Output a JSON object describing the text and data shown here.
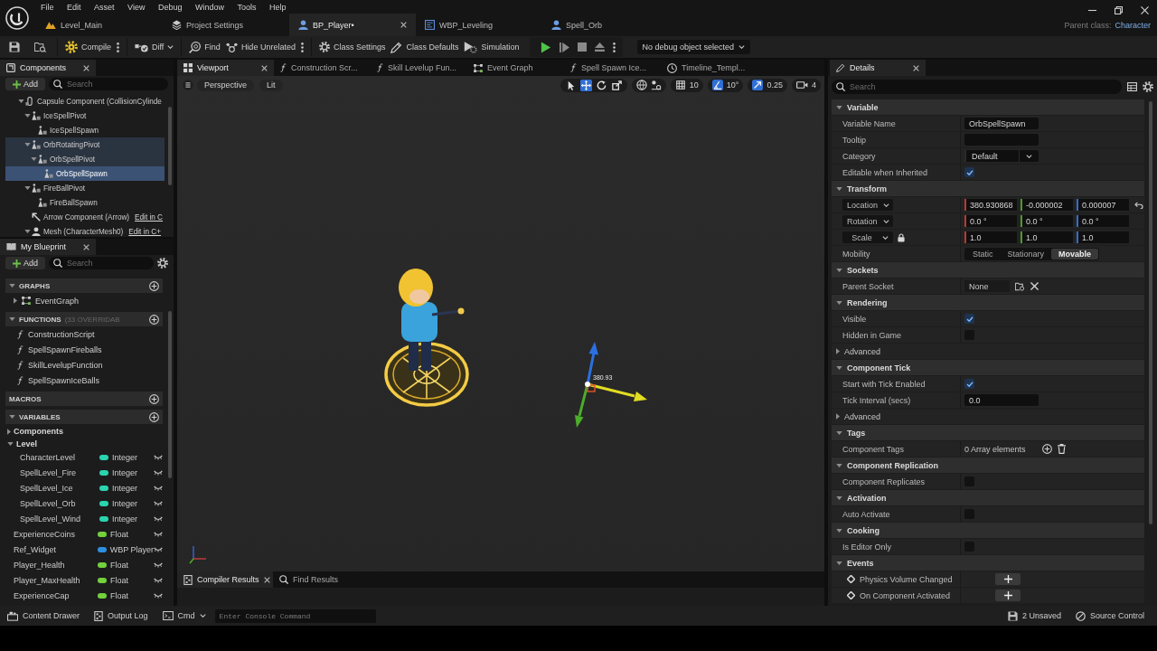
{
  "menu_bar": [
    "File",
    "Edit",
    "Asset",
    "View",
    "Debug",
    "Window",
    "Tools",
    "Help"
  ],
  "document_tabs": [
    {
      "label": "Level_Main",
      "kind": "level",
      "selected": false
    },
    {
      "label": "Project Settings",
      "kind": "settings",
      "selected": false
    },
    {
      "label": "BP_Player•",
      "kind": "blueprint",
      "selected": true
    },
    {
      "label": "WBP_Leveling",
      "kind": "widget",
      "selected": false
    },
    {
      "label": "Spell_Orb",
      "kind": "blueprint",
      "selected": false
    }
  ],
  "parent_class": {
    "label": "Parent class:",
    "value": "Character"
  },
  "toolbar": {
    "buttons": [
      {
        "label": "Compile",
        "kind": "compile"
      },
      {
        "label": "Diff",
        "kind": "diff"
      },
      {
        "label": "Find",
        "kind": "find"
      },
      {
        "label": "Hide Unrelated",
        "kind": "hide"
      },
      {
        "label": "Class Settings",
        "kind": "class_settings"
      },
      {
        "label": "Class Defaults",
        "kind": "class_defaults"
      },
      {
        "label": "Simulation",
        "kind": "simulation"
      }
    ],
    "debug_selector": "No debug object selected"
  },
  "components_panel": {
    "title": "Components",
    "add_label": "Add",
    "search_placeholder": "Search",
    "tree": [
      {
        "label": "Capsule Component (CollisionCylinde",
        "kind": "capsule",
        "expanded": true,
        "selected": false,
        "children": [
          {
            "label": "IceSpellPivot",
            "kind": "scene",
            "expanded": true,
            "selected": false,
            "children": [
              {
                "label": "IceSpellSpawn",
                "kind": "scene",
                "selected": false
              }
            ]
          },
          {
            "label": "OrbRotatingPivot",
            "kind": "scene",
            "expanded": true,
            "selected": false,
            "children": [
              {
                "label": "OrbSpellPivot",
                "kind": "scene",
                "expanded": true,
                "selected": false,
                "children": [
                  {
                    "label": "OrbSpellSpawn",
                    "kind": "scene",
                    "selected": true
                  }
                ]
              }
            ]
          },
          {
            "label": "FireBallPivot",
            "kind": "scene",
            "expanded": true,
            "selected": false,
            "children": [
              {
                "label": "FireBallSpawn",
                "kind": "scene",
                "selected": false
              }
            ]
          },
          {
            "label": "Arrow Component (Arrow)",
            "kind": "arrow",
            "selected": false,
            "link": "Edit in C"
          },
          {
            "label": "Mesh (CharacterMesh0)",
            "kind": "mesh",
            "expanded": true,
            "selected": false,
            "link": "Edit in C+"
          }
        ]
      }
    ]
  },
  "my_blueprint": {
    "title": "My Blueprint",
    "add_label": "Add",
    "search_placeholder": "Search",
    "sections": [
      {
        "title": "GRAPHS",
        "expanded": true,
        "items": [
          {
            "label": "EventGraph",
            "kind": "graph",
            "expanded": false
          }
        ]
      },
      {
        "title": "FUNCTIONS",
        "note": "(33 OVERRIDAB",
        "expanded": true,
        "items": [
          {
            "label": "ConstructionScript",
            "kind": "construction"
          },
          {
            "label": "SpellSpawnFireballs",
            "kind": "function"
          },
          {
            "label": "SkillLevelupFunction",
            "kind": "function"
          },
          {
            "label": "SpellSpawnIceBalls",
            "kind": "function"
          }
        ]
      },
      {
        "title": "MACROS"
      },
      {
        "title": "VARIABLES",
        "expanded": true,
        "groups": [
          {
            "label": "Components",
            "expanded": false
          },
          {
            "label": "Level",
            "expanded": true,
            "items": [
              {
                "name": "CharacterLevel",
                "type": "Integer",
                "color": "#2ad4b0"
              },
              {
                "name": "SpellLevel_Fire",
                "type": "Integer",
                "color": "#2ad4b0"
              },
              {
                "name": "SpellLevel_Ice",
                "type": "Integer",
                "color": "#2ad4b0"
              },
              {
                "name": "SpellLevel_Orb",
                "type": "Integer",
                "color": "#2ad4b0"
              },
              {
                "name": "SpellLevel_Wind",
                "type": "Integer",
                "color": "#2ad4b0"
              }
            ]
          }
        ],
        "items": [
          {
            "name": "ExperienceCoins",
            "type": "Float",
            "color": "#72d13c"
          },
          {
            "name": "Ref_Widget",
            "type": "WBP Player",
            "color": "#2d8fe0"
          },
          {
            "name": "Player_Health",
            "type": "Float",
            "color": "#72d13c"
          },
          {
            "name": "Player_MaxHealth",
            "type": "Float",
            "color": "#72d13c"
          },
          {
            "name": "ExperienceCap",
            "type": "Float",
            "color": "#72d13c"
          }
        ]
      }
    ]
  },
  "editor_tabs": [
    {
      "label": "Viewport",
      "kind": "viewport",
      "selected": true
    },
    {
      "label": "Construction Scr...",
      "kind": "function",
      "selected": false
    },
    {
      "label": "Skill Levelup Fun...",
      "kind": "function",
      "selected": false
    },
    {
      "label": "Event Graph",
      "kind": "graph",
      "selected": false
    },
    {
      "label": "Spell Spawn Ice...",
      "kind": "function",
      "selected": false
    },
    {
      "label": "Timeline_Templ...",
      "kind": "timeline",
      "selected": false
    }
  ],
  "viewport": {
    "view_mode": "Perspective",
    "lighting": "Lit",
    "transform_tools": [
      {
        "kind": "select",
        "selected": false
      },
      {
        "kind": "translate",
        "selected": true
      },
      {
        "kind": "rotate",
        "selected": false
      },
      {
        "kind": "scale",
        "selected": false
      }
    ],
    "snaps": [
      {
        "kind": "grid",
        "value": "10",
        "on": false
      },
      {
        "kind": "angle",
        "value": "10°",
        "on": true
      },
      {
        "kind": "scale",
        "value": "0.25",
        "on": true
      },
      {
        "kind": "camera",
        "value": "4",
        "on": false
      }
    ],
    "gizmo_reading": "380.93"
  },
  "bottom_tabs": [
    {
      "label": "Compiler Results",
      "kind": "compiler",
      "selected": true
    },
    {
      "label": "Find Results",
      "kind": "find",
      "selected": false
    }
  ],
  "details": {
    "title": "Details",
    "search_placeholder": "Search",
    "sections": [
      {
        "title": "Variable",
        "expanded": true,
        "rows": [
          {
            "kind": "text",
            "label": "Variable Name",
            "value": "OrbSpellSpawn"
          },
          {
            "kind": "text",
            "label": "Tooltip"
          },
          {
            "kind": "dropdown",
            "label": "Category",
            "value": "Default"
          },
          {
            "kind": "checkbox",
            "label": "Editable when Inherited",
            "checked": true
          }
        ]
      },
      {
        "title": "Transform",
        "expanded": true,
        "rows": [
          {
            "kind": "vector",
            "label": "Location",
            "values": [
              "380.930868",
              "-0.000002",
              "0.000007"
            ],
            "modified": true,
            "locked": false
          },
          {
            "kind": "vector",
            "label": "Rotation",
            "values": [
              "0.0 °",
              "0.0 °",
              "0.0 °"
            ],
            "modified": false,
            "locked": false
          },
          {
            "kind": "vector",
            "label": "Scale",
            "values": [
              "1.0",
              "1.0",
              "1.0"
            ],
            "modified": false,
            "locked": true
          },
          {
            "kind": "segmented",
            "label": "Mobility",
            "options": [
              {
                "label": "Static",
                "selected": false
              },
              {
                "label": "Stationary",
                "selected": false
              },
              {
                "label": "Movable",
                "selected": true
              }
            ]
          }
        ]
      },
      {
        "title": "Sockets",
        "expanded": true,
        "rows": [
          {
            "kind": "socket",
            "label": "Parent Socket",
            "value": "None"
          }
        ]
      },
      {
        "title": "Rendering",
        "expanded": true,
        "rows": [
          {
            "kind": "checkbox",
            "label": "Visible",
            "checked": true
          },
          {
            "kind": "checkbox",
            "label": "Hidden in Game",
            "checked": false
          },
          {
            "kind": "advanced",
            "label": "Advanced",
            "expanded": false
          }
        ]
      },
      {
        "title": "Component Tick",
        "expanded": true,
        "rows": [
          {
            "kind": "checkbox",
            "label": "Start with Tick Enabled",
            "checked": true
          },
          {
            "kind": "text",
            "label": "Tick Interval (secs)",
            "value": "0.0"
          },
          {
            "kind": "advanced",
            "label": "Advanced",
            "expanded": false
          }
        ]
      },
      {
        "title": "Tags",
        "expanded": true,
        "rows": [
          {
            "kind": "array",
            "label": "Component Tags",
            "value": "0 Array elements"
          }
        ]
      },
      {
        "title": "Component Replication",
        "expanded": true,
        "rows": [
          {
            "kind": "checkbox",
            "label": "Component Replicates",
            "checked": false
          }
        ]
      },
      {
        "title": "Activation",
        "expanded": true,
        "rows": [
          {
            "kind": "checkbox",
            "label": "Auto Activate",
            "checked": false
          }
        ]
      },
      {
        "title": "Cooking",
        "expanded": true,
        "rows": [
          {
            "kind": "checkbox",
            "label": "Is Editor Only",
            "checked": false
          }
        ]
      },
      {
        "title": "Events",
        "expanded": true,
        "rows": [
          {
            "kind": "event",
            "label": "Physics Volume Changed"
          },
          {
            "kind": "event",
            "label": "On Component Activated"
          }
        ]
      }
    ]
  },
  "status_bar": {
    "content_drawer": "Content Drawer",
    "output_log": "Output Log",
    "cmd": "Cmd",
    "console_placeholder": "Enter Console Command",
    "unsaved": "2 Unsaved",
    "source_control": "Source Control"
  }
}
